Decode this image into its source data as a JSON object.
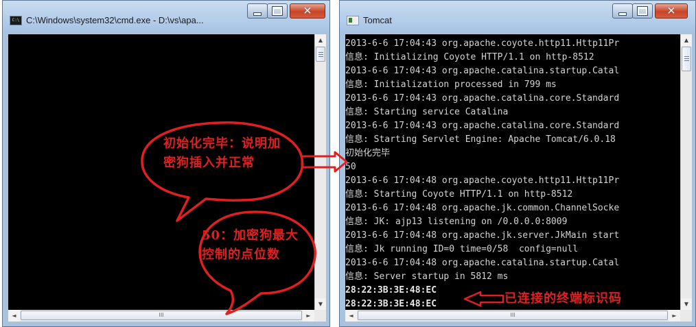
{
  "windows": {
    "cmd": {
      "title": "C:\\Windows\\system32\\cmd.exe - D:\\vs\\apa...",
      "icon": "console-icon"
    },
    "tomcat": {
      "title": "Tomcat",
      "icon": "java-app-icon",
      "log_lines": [
        "2013-6-6 17:04:43 org.apache.coyote.http11.Http11Pr",
        "信息: Initializing Coyote HTTP/1.1 on http-8512",
        "2013-6-6 17:04:43 org.apache.catalina.startup.Catal",
        "信息: Initialization processed in 799 ms",
        "2013-6-6 17:04:43 org.apache.catalina.core.Standard",
        "信息: Starting service Catalina",
        "2013-6-6 17:04:43 org.apache.catalina.core.Standard",
        "信息: Starting Servlet Engine: Apache Tomcat/6.0.18",
        "初始化完毕",
        "50",
        "2013-6-6 17:04:48 org.apache.coyote.http11.Http11Pr",
        "信息: Starting Coyote HTTP/1.1 on http-8512",
        "2013-6-6 17:04:48 org.apache.jk.common.ChannelSocke",
        "信息: JK: ajp13 listening on /0.0.0.0:8009",
        "2013-6-6 17:04:48 org.apache.jk.server.JkMain start",
        "信息: Jk running ID=0 time=0/58  config=null",
        "2013-6-6 17:04:48 org.apache.catalina.startup.Catal",
        "信息: Server startup in 5812 ms",
        "28:22:3B:3E:48:EC",
        "28:22:3B:3E:48:EC"
      ]
    }
  },
  "scrollbar": {
    "up": "▲",
    "down": "▼",
    "left": "◄",
    "right": "►",
    "grip": "III"
  },
  "annotations": {
    "bubble1": "初始化完毕：说明加密狗插入并正常",
    "bubble2": "50：加密狗最大控制的点位数",
    "terminal_id": "已连接的终端标识码"
  },
  "colors": {
    "annotation": "#e02020",
    "console_bg": "#000000",
    "console_text": "#d4d4d4"
  }
}
